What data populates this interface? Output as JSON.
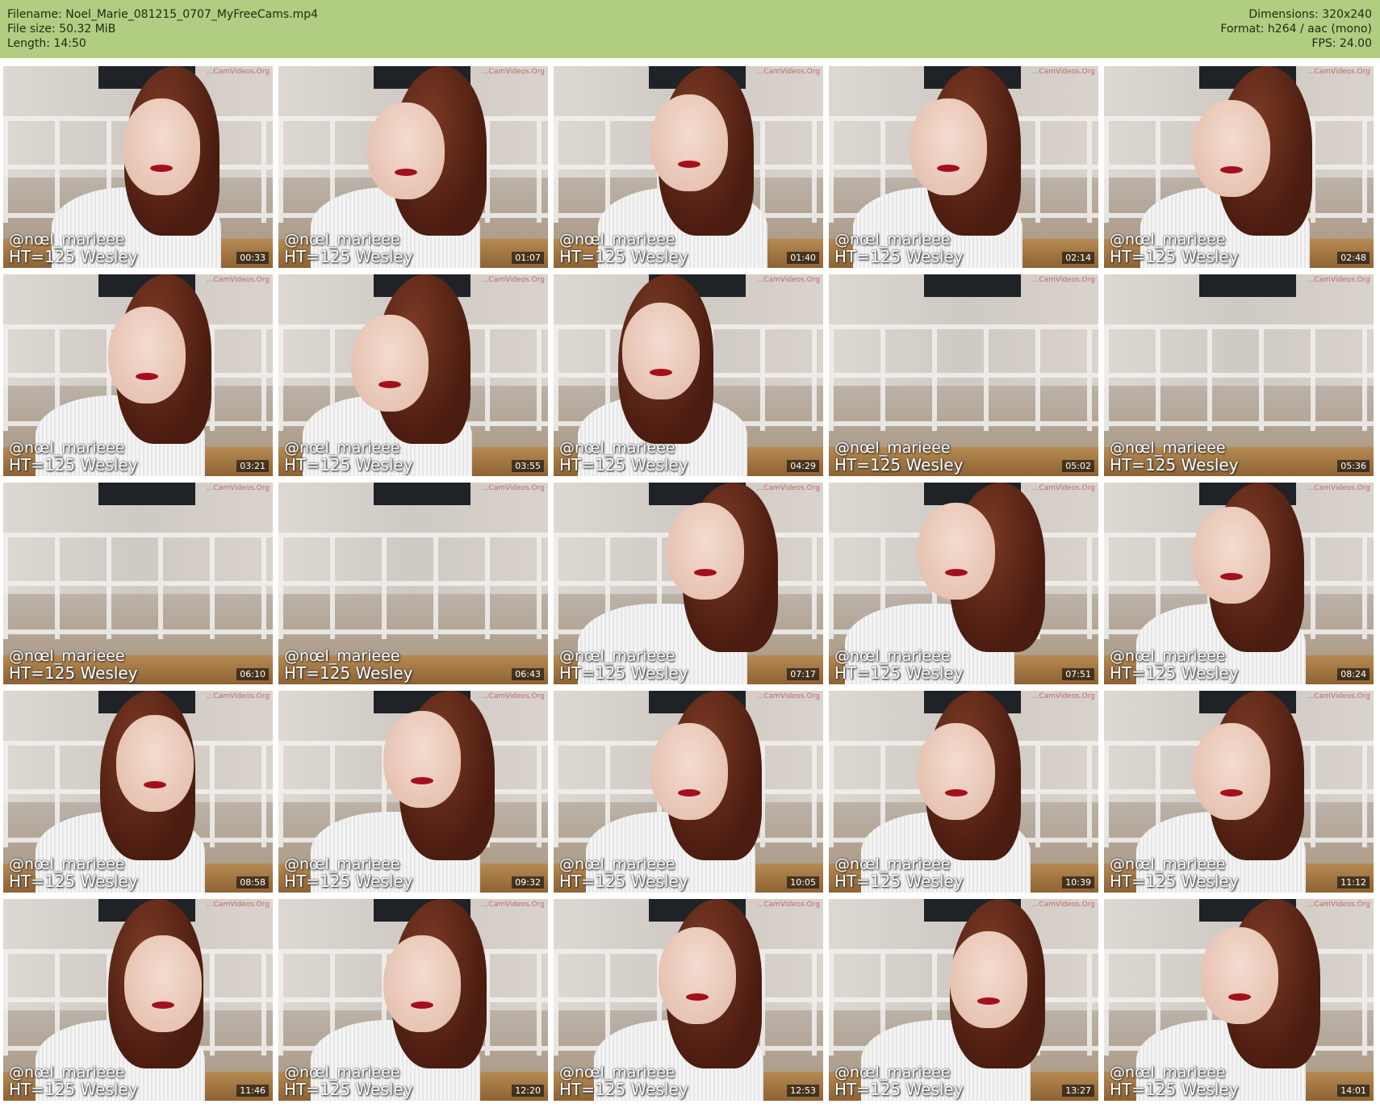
{
  "header": {
    "filename_line": "Filename: Noel_Marie_081215_0707_MyFreeCams.mp4",
    "filesize_line": "File size: 50.32 MiB",
    "length_line": "Length: 14:50",
    "dimensions_line": "Dimensions: 320x240",
    "format_line": "Format: h264 / aac (mono)",
    "fps_line": "FPS: 24.00",
    "background_color": "#b1cd82"
  },
  "watermark": {
    "handle": "@nœl_marieee",
    "tip": "HT=125 Wesley",
    "corner": "...CamVideos.Org"
  },
  "timestamps": [
    "00:33",
    "01:07",
    "01:40",
    "02:14",
    "02:48",
    "03:21",
    "03:55",
    "04:29",
    "05:02",
    "05:36",
    "06:10",
    "06:43",
    "07:17",
    "07:51",
    "08:24",
    "08:58",
    "09:32",
    "10:05",
    "10:39",
    "11:12",
    "11:46",
    "12:20",
    "12:53",
    "13:27",
    "14:01"
  ]
}
